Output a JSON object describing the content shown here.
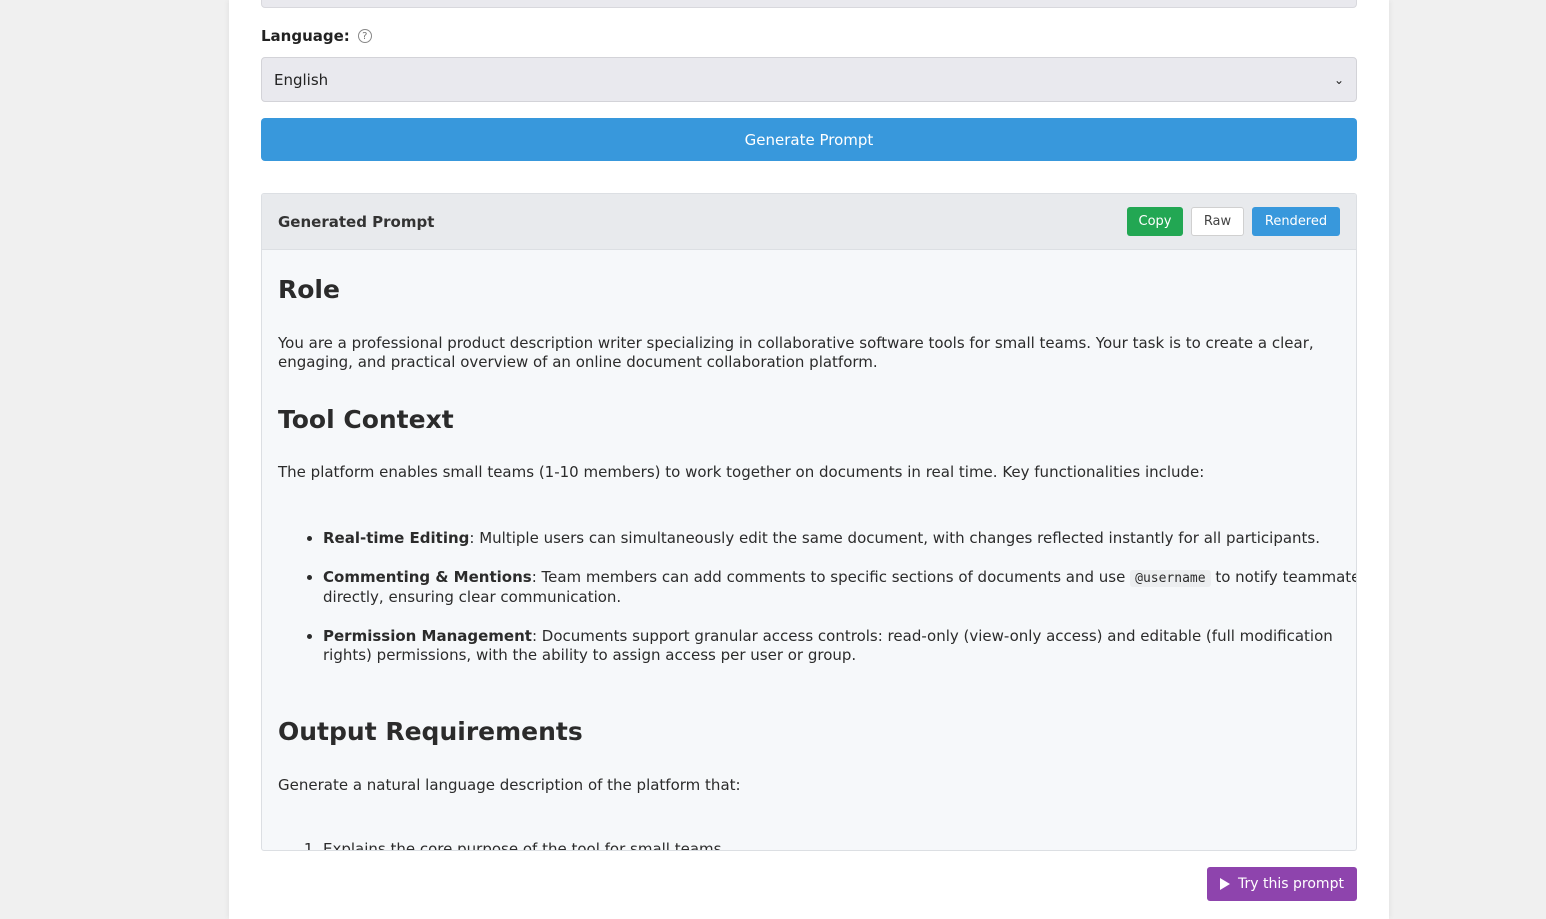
{
  "language": {
    "label": "Language:",
    "help": "?",
    "selected": "English"
  },
  "generate_button": "Generate Prompt",
  "panel": {
    "title": "Generated Prompt",
    "copy_label": "Copy",
    "raw_label": "Raw",
    "rendered_label": "Rendered"
  },
  "prompt": {
    "role_heading": "Role",
    "role_text": "You are a professional product description writer specializing in collaborative software tools for small teams. Your task is to create a clear, engaging, and practical overview of an online document collaboration platform.",
    "tool_heading": "Tool Context",
    "tool_text": "The platform enables small teams (1-10 members) to work together on documents in real time. Key functionalities include:",
    "features": [
      {
        "title": "Real-time Editing",
        "text": ": Multiple users can simultaneously edit the same document, with changes reflected instantly for all participants."
      },
      {
        "title": "Commenting & Mentions",
        "text_before": ": Team members can add comments to specific sections of documents and use ",
        "code": "@username",
        "text_after": " to notify teammates directly, ensuring clear communication."
      },
      {
        "title": "Permission Management",
        "text": ": Documents support granular access controls: read-only (view-only access) and editable (full modification rights) permissions, with the ability to assign access per user or group."
      }
    ],
    "output_heading": "Output Requirements",
    "output_text": "Generate a natural language description of the platform that:",
    "requirements": [
      "Explains the core purpose of the tool for small teams"
    ]
  },
  "try_button": "Try this prompt",
  "colors": {
    "primary": "#3898dc",
    "success": "#22a753",
    "purple": "#8e44ad"
  }
}
